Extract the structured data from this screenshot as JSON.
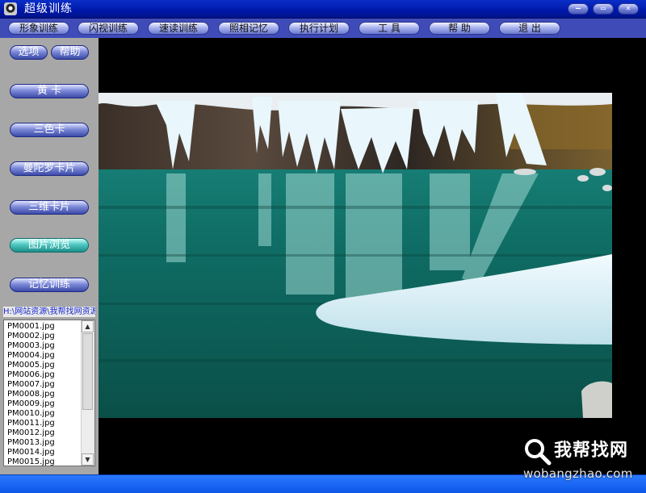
{
  "window": {
    "title": "超级训练",
    "minimize_symbol": "—",
    "maximize_symbol": "▭",
    "close_symbol": "✕"
  },
  "menu": [
    {
      "label": "形象训练"
    },
    {
      "label": "闪视训练"
    },
    {
      "label": "速读训练"
    },
    {
      "label": "照相记忆"
    },
    {
      "label": "执行计划"
    },
    {
      "label": "工 具"
    },
    {
      "label": "帮 助"
    },
    {
      "label": "退 出"
    }
  ],
  "sidebar": {
    "options_label": "选项",
    "help_label": "帮助",
    "buttons": [
      {
        "label": "黄 卡"
      },
      {
        "label": "三色卡"
      },
      {
        "label": "曼陀罗卡片"
      },
      {
        "label": "三维卡片"
      },
      {
        "label": "图片浏览"
      },
      {
        "label": "记忆训练"
      }
    ],
    "active_button": "图片浏览",
    "path": "H:\\网站资源\\我帮找网资源",
    "files": [
      "PM0001.jpg",
      "PM0002.jpg",
      "PM0003.jpg",
      "PM0004.jpg",
      "PM0005.jpg",
      "PM0006.jpg",
      "PM0007.jpg",
      "PM0008.jpg",
      "PM0009.jpg",
      "PM0010.jpg",
      "PM0011.jpg",
      "PM0012.jpg",
      "PM0013.jpg",
      "PM0014.jpg",
      "PM0015.jpg"
    ],
    "scroll_up_symbol": "▲",
    "scroll_down_symbol": "▼"
  },
  "watermark": {
    "brand": "我帮找网",
    "url": "wobangzhao.com"
  },
  "colors": {
    "title_bar": "#0018a8",
    "menu_bar": "#3f4cb8",
    "side_panel": "#a7a7a7",
    "status_bar": "#0e57e8",
    "active_button": "#4fc7c0"
  }
}
